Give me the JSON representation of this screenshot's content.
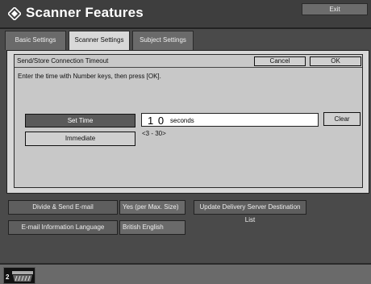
{
  "header": {
    "title": "Scanner Features",
    "exit_label": "Exit"
  },
  "tabs": [
    {
      "label": "Basic Settings",
      "active": false
    },
    {
      "label": "Scanner Settings",
      "active": true
    },
    {
      "label": "Subject Settings",
      "active": false
    }
  ],
  "dialog": {
    "title": "Send/Store Connection Timeout",
    "cancel_label": "Cancel",
    "ok_label": "OK",
    "instruction": "Enter the time with Number keys, then press [OK].",
    "set_time_label": "Set Time",
    "immediate_label": "Immediate",
    "value": "1 0",
    "unit": "seconds",
    "clear_label": "Clear",
    "range": "<3 - 30>"
  },
  "settings": [
    {
      "label": "Divide & Send E-mail",
      "value": "Yes (per Max. Size)"
    },
    {
      "label": "E-mail Information Language",
      "value": "British English"
    }
  ],
  "update_label": "Update Delivery Server Destination List",
  "status": {
    "count": "2"
  }
}
